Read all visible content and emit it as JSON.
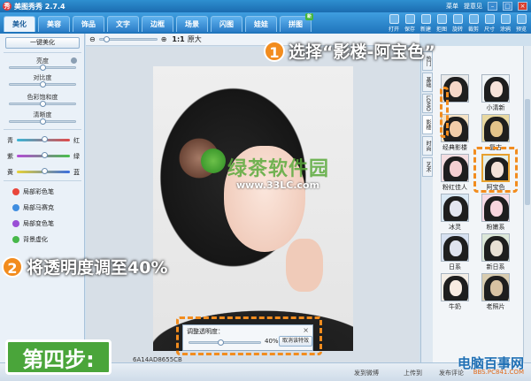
{
  "app": {
    "title": "美图秀秀 2.7.4",
    "logo": "秀"
  },
  "titlebar": {
    "menu": "菜单",
    "feedback": "提意见"
  },
  "tabs": [
    {
      "label": "美化"
    },
    {
      "label": "美容"
    },
    {
      "label": "饰品"
    },
    {
      "label": "文字"
    },
    {
      "label": "边框"
    },
    {
      "label": "场景"
    },
    {
      "label": "闪图"
    },
    {
      "label": "娃娃"
    },
    {
      "label": "拼图"
    }
  ],
  "tab_new_badge": "新",
  "toolbar": [
    {
      "label": "打开"
    },
    {
      "label": "保存"
    },
    {
      "label": "新建"
    },
    {
      "label": "拒图"
    },
    {
      "label": "旋转"
    },
    {
      "label": "裁剪"
    },
    {
      "label": "尺寸"
    },
    {
      "label": "涂鸦"
    },
    {
      "label": "预览"
    }
  ],
  "sidebar": {
    "onekey": "一键美化",
    "adjust": [
      {
        "label": "亮度",
        "value": 0.5
      },
      {
        "label": "对比度",
        "value": 0.5
      },
      {
        "label": "色彩饱和度",
        "value": 0.5
      },
      {
        "label": "清晰度",
        "value": 0.5
      }
    ],
    "colors": [
      {
        "left": "青",
        "right": "红",
        "value": 0.5
      },
      {
        "left": "紫",
        "right": "绿",
        "value": 0.5
      },
      {
        "left": "黄",
        "right": "蓝",
        "value": 0.5
      }
    ],
    "brushes": [
      {
        "label": "局部彩色笔"
      },
      {
        "label": "局部马赛克"
      },
      {
        "label": "局部变色笔"
      },
      {
        "label": "背景虚化"
      }
    ]
  },
  "canvasbar": {
    "zoom_label": "1:1",
    "original": "原大",
    "zoom_value": 0.1
  },
  "watermark": {
    "name": "绿茶软件园",
    "url": "www.33LC.com"
  },
  "dialog": {
    "title": "调整透明度：",
    "value": "40%",
    "cancel": "取消该特效",
    "slider": 0.4
  },
  "right_tabs": [
    {
      "label": "热门"
    },
    {
      "label": "基础"
    },
    {
      "label": "LOMO"
    },
    {
      "label": "影楼"
    },
    {
      "label": "时尚"
    },
    {
      "label": "艺术"
    }
  ],
  "effects": [
    {
      "label": ""
    },
    {
      "label": "小清新"
    },
    {
      "label": "经典影楼"
    },
    {
      "label": "复古"
    },
    {
      "label": "粉红佳人"
    },
    {
      "label": "阿宝色"
    },
    {
      "label": "冰灵"
    },
    {
      "label": "粉嫩系"
    },
    {
      "label": "日系"
    },
    {
      "label": "新日系"
    },
    {
      "label": "牛奶"
    },
    {
      "label": "老照片"
    }
  ],
  "status": {
    "weibo": "发到微博",
    "upload": "上传到",
    "share": "发布评论",
    "file": "6A14AD8655CB"
  },
  "annotations": {
    "step1_num": "1",
    "step1": "选择“影楼-阿宝色”",
    "step2_num": "2",
    "step2": "将透明度调至40%",
    "step": "第四步:"
  },
  "brand": {
    "name": "电脑百事网",
    "url": "BBS.PC841.COM"
  }
}
